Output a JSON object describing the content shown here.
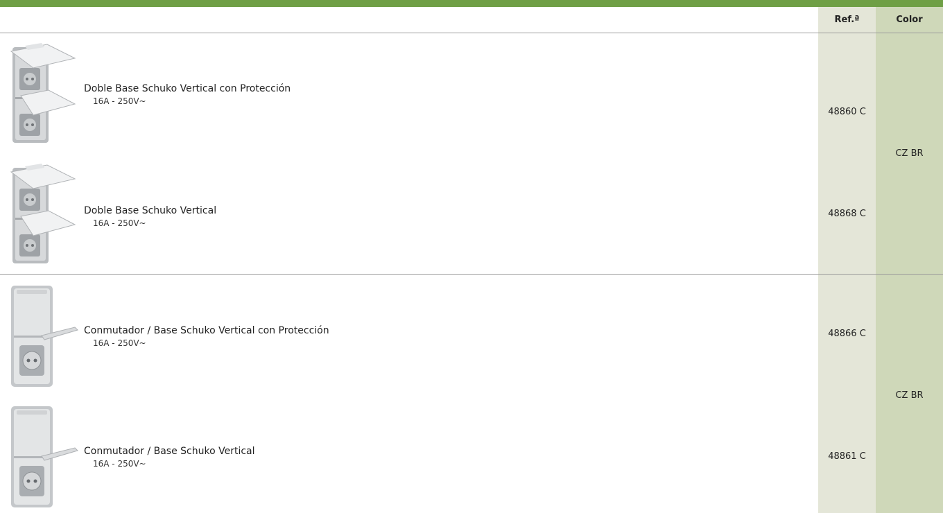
{
  "header": {
    "ref_label": "Ref.ª",
    "color_label": "Color"
  },
  "groups": [
    {
      "color": "CZ BR",
      "products": [
        {
          "name": "Doble Base Schuko Vertical con Protección",
          "spec": "16A - 250V~",
          "ref": "48860 C",
          "image": "double-socket-lid-icon"
        },
        {
          "name": "Doble Base Schuko Vertical",
          "spec": "16A - 250V~",
          "ref": "48868 C",
          "image": "double-socket-lid-icon"
        }
      ]
    },
    {
      "color": "CZ BR",
      "products": [
        {
          "name": "Conmutador / Base Schuko Vertical con Protección",
          "spec": "16A - 250V~",
          "ref": "48866 C",
          "image": "switch-socket-icon"
        },
        {
          "name": "Conmutador / Base Schuko Vertical",
          "spec": "16A - 250V~",
          "ref": "48861 C",
          "image": "switch-socket-icon"
        }
      ]
    }
  ],
  "colors": {
    "brand_green": "#6f9f45",
    "ref_column": "#e4e6d8",
    "color_column": "#cfd8b9"
  }
}
